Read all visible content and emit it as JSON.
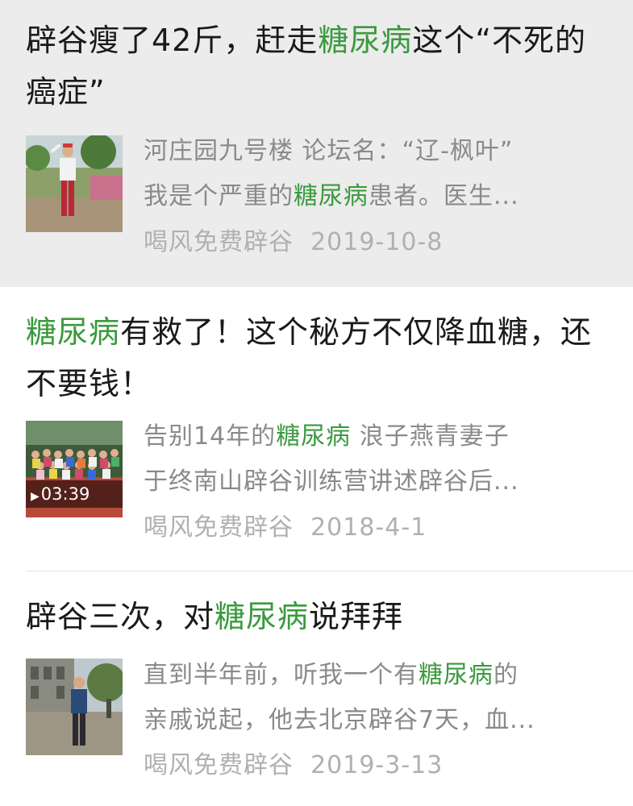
{
  "results": [
    {
      "title": {
        "before": "辟谷瘦了42斤，赶走",
        "highlight": "糖尿病",
        "after": "这个“不死的癌症”"
      },
      "snippet_line1": {
        "before": "河庄园九号楼 论坛名：“辽-枫叶”",
        "highlight": "",
        "after": ""
      },
      "snippet_line2": {
        "before": "我是个严重的",
        "highlight": "糖尿病",
        "after": "患者。医生..."
      },
      "source": "喝风免费辟谷",
      "date": "2019-10-8",
      "pressed": true
    },
    {
      "title": {
        "before": "",
        "highlight": "糖尿病",
        "after": "有救了！这个秘方不仅降血糖，还不要钱！"
      },
      "snippet_line1": {
        "before": "告别14年的",
        "highlight": "糖尿病",
        "after": " 浪子燕青妻子"
      },
      "snippet_line2": {
        "before": "于终南山辟谷训练营讲述辟谷后...",
        "highlight": "",
        "after": ""
      },
      "source": "喝风免费辟谷",
      "date": "2018-4-1",
      "video_duration": "03:39",
      "pressed": false
    },
    {
      "title": {
        "before": "辟谷三次，对",
        "highlight": "糖尿病",
        "after": "说拜拜"
      },
      "snippet_line1": {
        "before": "直到半年前，听我一个有",
        "highlight": "糖尿病",
        "after": "的"
      },
      "snippet_line2": {
        "before": "亲戚说起，他去北京辟谷7天，血...",
        "highlight": "",
        "after": ""
      },
      "source": "喝风免费辟谷",
      "date": "2019-3-13",
      "pressed": false
    }
  ],
  "colors": {
    "highlight": "#3a9a3e",
    "title": "#1a1a1a",
    "snippet": "#8a8a8a",
    "meta": "#b0b0b0",
    "pressed_bg": "#ececec"
  },
  "icons": {
    "video_play": "play-triangle-icon"
  }
}
